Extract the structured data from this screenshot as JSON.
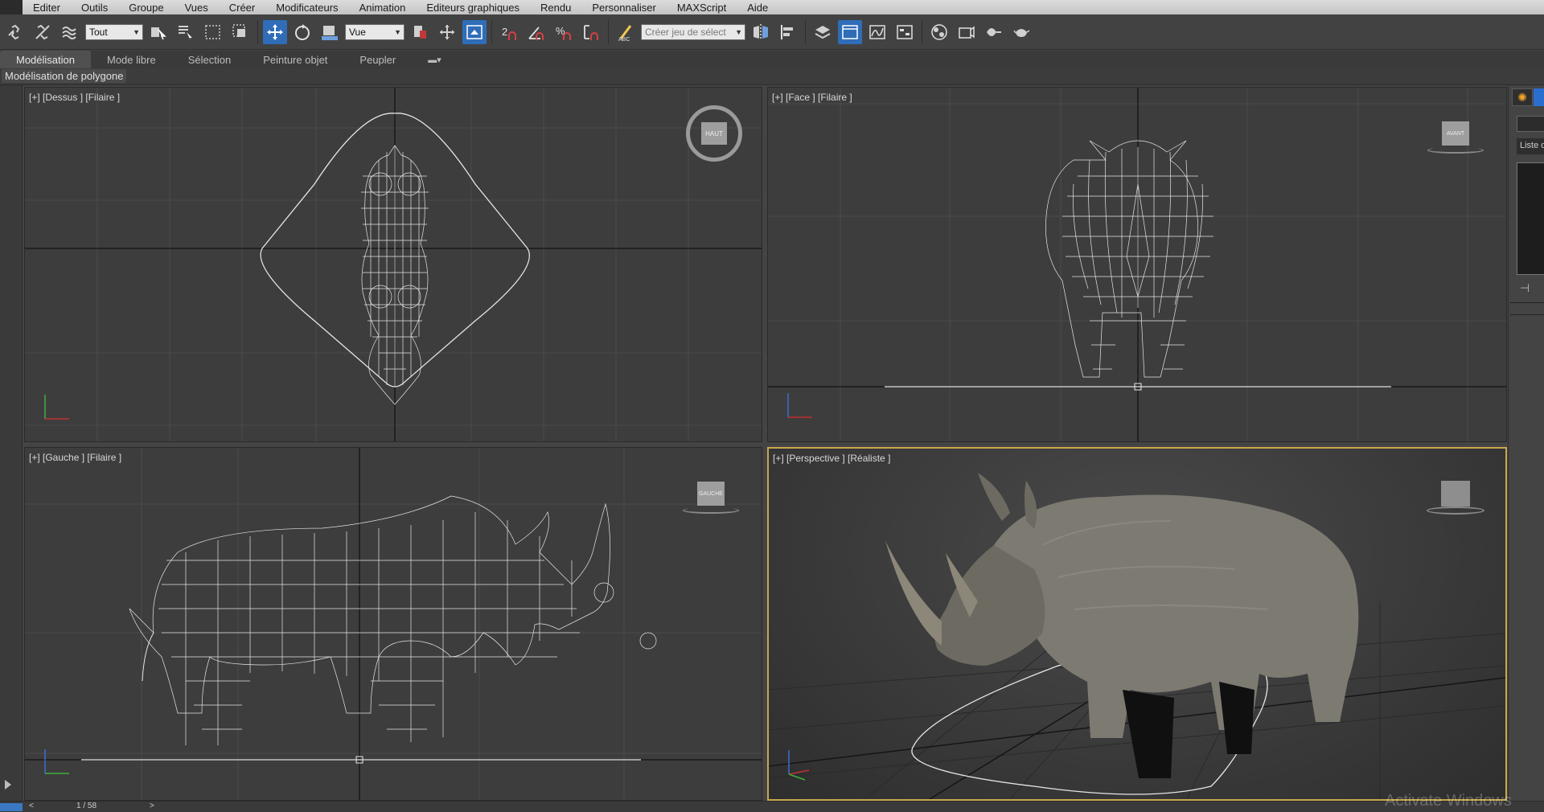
{
  "menubar": {
    "items": [
      "Editer",
      "Outils",
      "Groupe",
      "Vues",
      "Créer",
      "Modificateurs",
      "Animation",
      "Editeurs graphiques",
      "Rendu",
      "Personnaliser",
      "MAXScript",
      "Aide"
    ]
  },
  "toolbar": {
    "selection_filter": "Tout",
    "reference_coord": "Vue",
    "named_selection_placeholder": "Créer jeu de sélect",
    "icons": [
      "link-icon",
      "unlink-icon",
      "bind-spacewarp-icon",
      "select-object-icon",
      "select-by-name-icon",
      "rectangle-region-icon",
      "window-crossing-icon",
      "move-icon",
      "rotate-icon",
      "scale-icon",
      "pivot-icon",
      "manipulate-icon",
      "keyboard-shortcut-icon",
      "snap-2d-icon",
      "angle-snap-icon",
      "percent-snap-icon",
      "spinner-snap-icon",
      "edit-named-selection-icon",
      "mirror-icon",
      "align-icon",
      "layer-manager-icon",
      "scene-explorer-icon",
      "curve-editor-icon",
      "schematic-view-icon",
      "material-editor-icon",
      "render-setup-icon",
      "rendered-frame-icon",
      "render-teapot-icon"
    ],
    "active_tool": "move-icon"
  },
  "ribbon": {
    "tabs": [
      "Modélisation",
      "Mode libre",
      "Sélection",
      "Peinture objet",
      "Peupler"
    ],
    "active_tab": "Modélisation",
    "panel_label": "Modélisation de polygone"
  },
  "viewports": [
    {
      "id": "top",
      "label": "[+] [Dessus ] [Filaire ]",
      "viewcube": "HAUT",
      "active": false
    },
    {
      "id": "front",
      "label": "[+] [Face ] [Filaire ]",
      "viewcube": "AVANT",
      "active": false
    },
    {
      "id": "left",
      "label": "[+] [Gauche ] [Filaire ]",
      "viewcube": "GAUCHE",
      "active": false
    },
    {
      "id": "perspective",
      "label": "[+] [Perspective ] [Réaliste ]",
      "viewcube": "",
      "active": true
    }
  ],
  "command_panel": {
    "list_label": "Liste d"
  },
  "timeline": {
    "left_arrow": "<",
    "frame_counter": "1 / 58",
    "right_arrow": ">"
  },
  "watermark": "Activate Windows",
  "colors": {
    "accent_blue": "#2f6db8",
    "active_viewport_border": "#c8a84a",
    "wireframe": "#e6e6e6",
    "viewport_bg": "#3d3d3d"
  }
}
